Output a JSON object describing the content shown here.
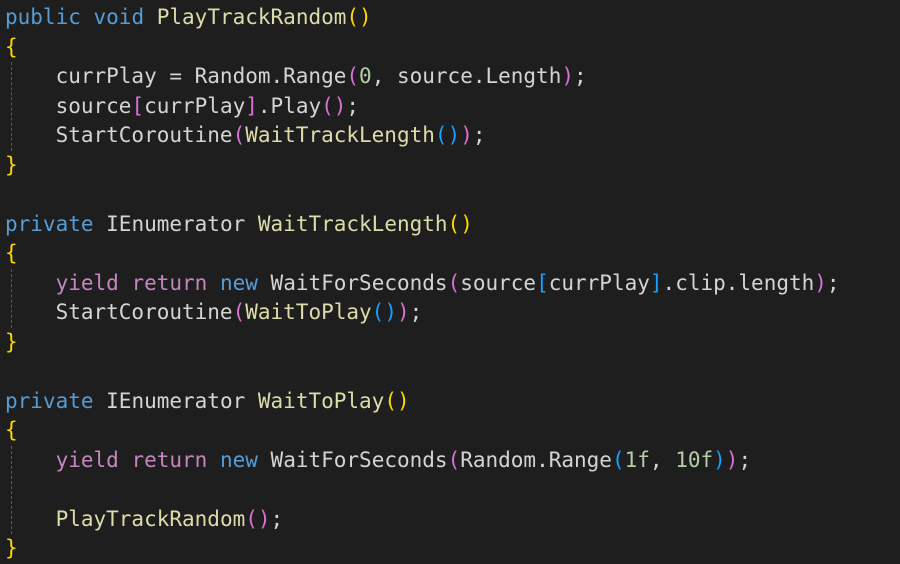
{
  "colors": {
    "background": "#1e1e1e",
    "keyword": "#569cd6",
    "control_keyword": "#c586c0",
    "function": "#dcdcaa",
    "text": "#d4d4d4",
    "number": "#b5cea8",
    "bracket_level1": "#ffd700",
    "bracket_level2": "#da70d6",
    "bracket_level3": "#179fff"
  },
  "code": {
    "lines": [
      [
        [
          "public",
          "kw"
        ],
        [
          " ",
          "pn"
        ],
        [
          "void",
          "kw"
        ],
        [
          " ",
          "pn"
        ],
        [
          "PlayTrackRandom",
          "fn"
        ],
        [
          "()",
          "br1"
        ]
      ],
      [
        [
          "{",
          "br1"
        ]
      ],
      [
        [
          "    currPlay = Random.Range",
          "ty"
        ],
        [
          "(",
          "br2"
        ],
        [
          "0",
          "num"
        ],
        [
          ", source.Length",
          "ty"
        ],
        [
          ")",
          "br2"
        ],
        [
          ";",
          "pn"
        ]
      ],
      [
        [
          "    source",
          "ty"
        ],
        [
          "[",
          "br2"
        ],
        [
          "currPlay",
          "ty"
        ],
        [
          "]",
          "br2"
        ],
        [
          ".Play",
          "ty"
        ],
        [
          "()",
          "br2"
        ],
        [
          ";",
          "pn"
        ]
      ],
      [
        [
          "    StartCoroutine",
          "ty"
        ],
        [
          "(",
          "br2"
        ],
        [
          "WaitTrackLength",
          "fn"
        ],
        [
          "()",
          "br3"
        ],
        [
          ")",
          "br2"
        ],
        [
          ";",
          "pn"
        ]
      ],
      [
        [
          "}",
          "br1"
        ]
      ],
      [],
      [
        [
          "private",
          "kw"
        ],
        [
          " IEnumerator ",
          "ty"
        ],
        [
          "WaitTrackLength",
          "fn"
        ],
        [
          "()",
          "br1"
        ]
      ],
      [
        [
          "{",
          "br1"
        ]
      ],
      [
        [
          "    ",
          "pn"
        ],
        [
          "yield",
          "ctl"
        ],
        [
          " ",
          "pn"
        ],
        [
          "return",
          "ctl"
        ],
        [
          " ",
          "pn"
        ],
        [
          "new",
          "kw"
        ],
        [
          " WaitForSeconds",
          "ty"
        ],
        [
          "(",
          "br2"
        ],
        [
          "source",
          "ty"
        ],
        [
          "[",
          "br3"
        ],
        [
          "currPlay",
          "ty"
        ],
        [
          "]",
          "br3"
        ],
        [
          ".clip.length",
          "ty"
        ],
        [
          ")",
          "br2"
        ],
        [
          ";",
          "pn"
        ]
      ],
      [
        [
          "    StartCoroutine",
          "ty"
        ],
        [
          "(",
          "br2"
        ],
        [
          "WaitToPlay",
          "fn"
        ],
        [
          "()",
          "br3"
        ],
        [
          ")",
          "br2"
        ],
        [
          ";",
          "pn"
        ]
      ],
      [
        [
          "}",
          "br1"
        ]
      ],
      [],
      [
        [
          "private",
          "kw"
        ],
        [
          " IEnumerator ",
          "ty"
        ],
        [
          "WaitToPlay",
          "fn"
        ],
        [
          "()",
          "br1"
        ]
      ],
      [
        [
          "{",
          "br1"
        ]
      ],
      [
        [
          "    ",
          "pn"
        ],
        [
          "yield",
          "ctl"
        ],
        [
          " ",
          "pn"
        ],
        [
          "return",
          "ctl"
        ],
        [
          " ",
          "pn"
        ],
        [
          "new",
          "kw"
        ],
        [
          " WaitForSeconds",
          "ty"
        ],
        [
          "(",
          "br2"
        ],
        [
          "Random.Range",
          "ty"
        ],
        [
          "(",
          "br3"
        ],
        [
          "1f",
          "num"
        ],
        [
          ", ",
          "ty"
        ],
        [
          "10f",
          "num"
        ],
        [
          ")",
          "br3"
        ],
        [
          ")",
          "br2"
        ],
        [
          ";",
          "pn"
        ]
      ],
      [],
      [
        [
          "    ",
          "pn"
        ],
        [
          "PlayTrackRandom",
          "fn"
        ],
        [
          "()",
          "br2"
        ],
        [
          ";",
          "pn"
        ]
      ],
      [
        [
          "}",
          "br1"
        ]
      ]
    ]
  }
}
